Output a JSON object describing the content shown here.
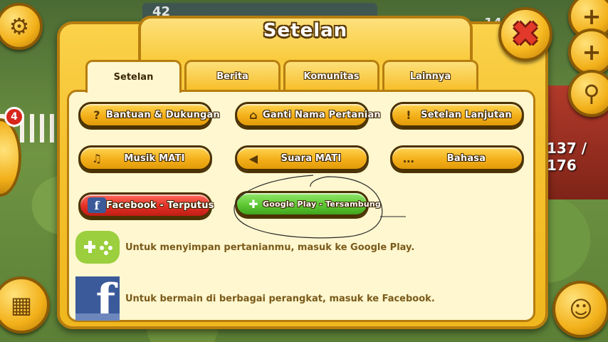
{
  "hud": {
    "level": "42",
    "left_badge": "4",
    "top_right_value": "14",
    "barn_counter": "137 / 176"
  },
  "dialog": {
    "title": "Setelan",
    "tabs": [
      {
        "label": "Setelan",
        "active": true
      },
      {
        "label": "Berita",
        "active": false
      },
      {
        "label": "Komunitas",
        "active": false
      },
      {
        "label": "Lainnya",
        "active": false
      }
    ],
    "buttons": {
      "help": {
        "label": "Bantuan & Dukungan",
        "icon": "question-icon"
      },
      "rename": {
        "label": "Ganti Nama Pertanian",
        "icon": "farm-house-icon"
      },
      "advanced": {
        "label": "Setelan Lanjutan",
        "icon": "exclamation-icon"
      },
      "music": {
        "label": "Musik MATI",
        "icon": "music-note-icon"
      },
      "sound": {
        "label": "Suara MATI",
        "icon": "speaker-icon"
      },
      "language": {
        "label": "Bahasa",
        "icon": "speech-bubble-icon"
      },
      "facebook": {
        "label": "Facebook - Terputus",
        "icon": "facebook-icon"
      },
      "google_play": {
        "label": "Google Play - Tersambung",
        "icon": "gamepad-icon"
      }
    },
    "info": {
      "google_play": "Untuk menyimpan pertanianmu, masuk ke Google Play.",
      "facebook": "Untuk bermain di berbagai perangkat, masuk ke Facebook."
    }
  },
  "colors": {
    "dialog_yellow": "#f5c230",
    "panel_cream": "#fef7cf",
    "button_orange": "#f4b01b",
    "facebook_red": "#e32f25",
    "google_green": "#5ec833",
    "close_red": "#e2392a"
  }
}
